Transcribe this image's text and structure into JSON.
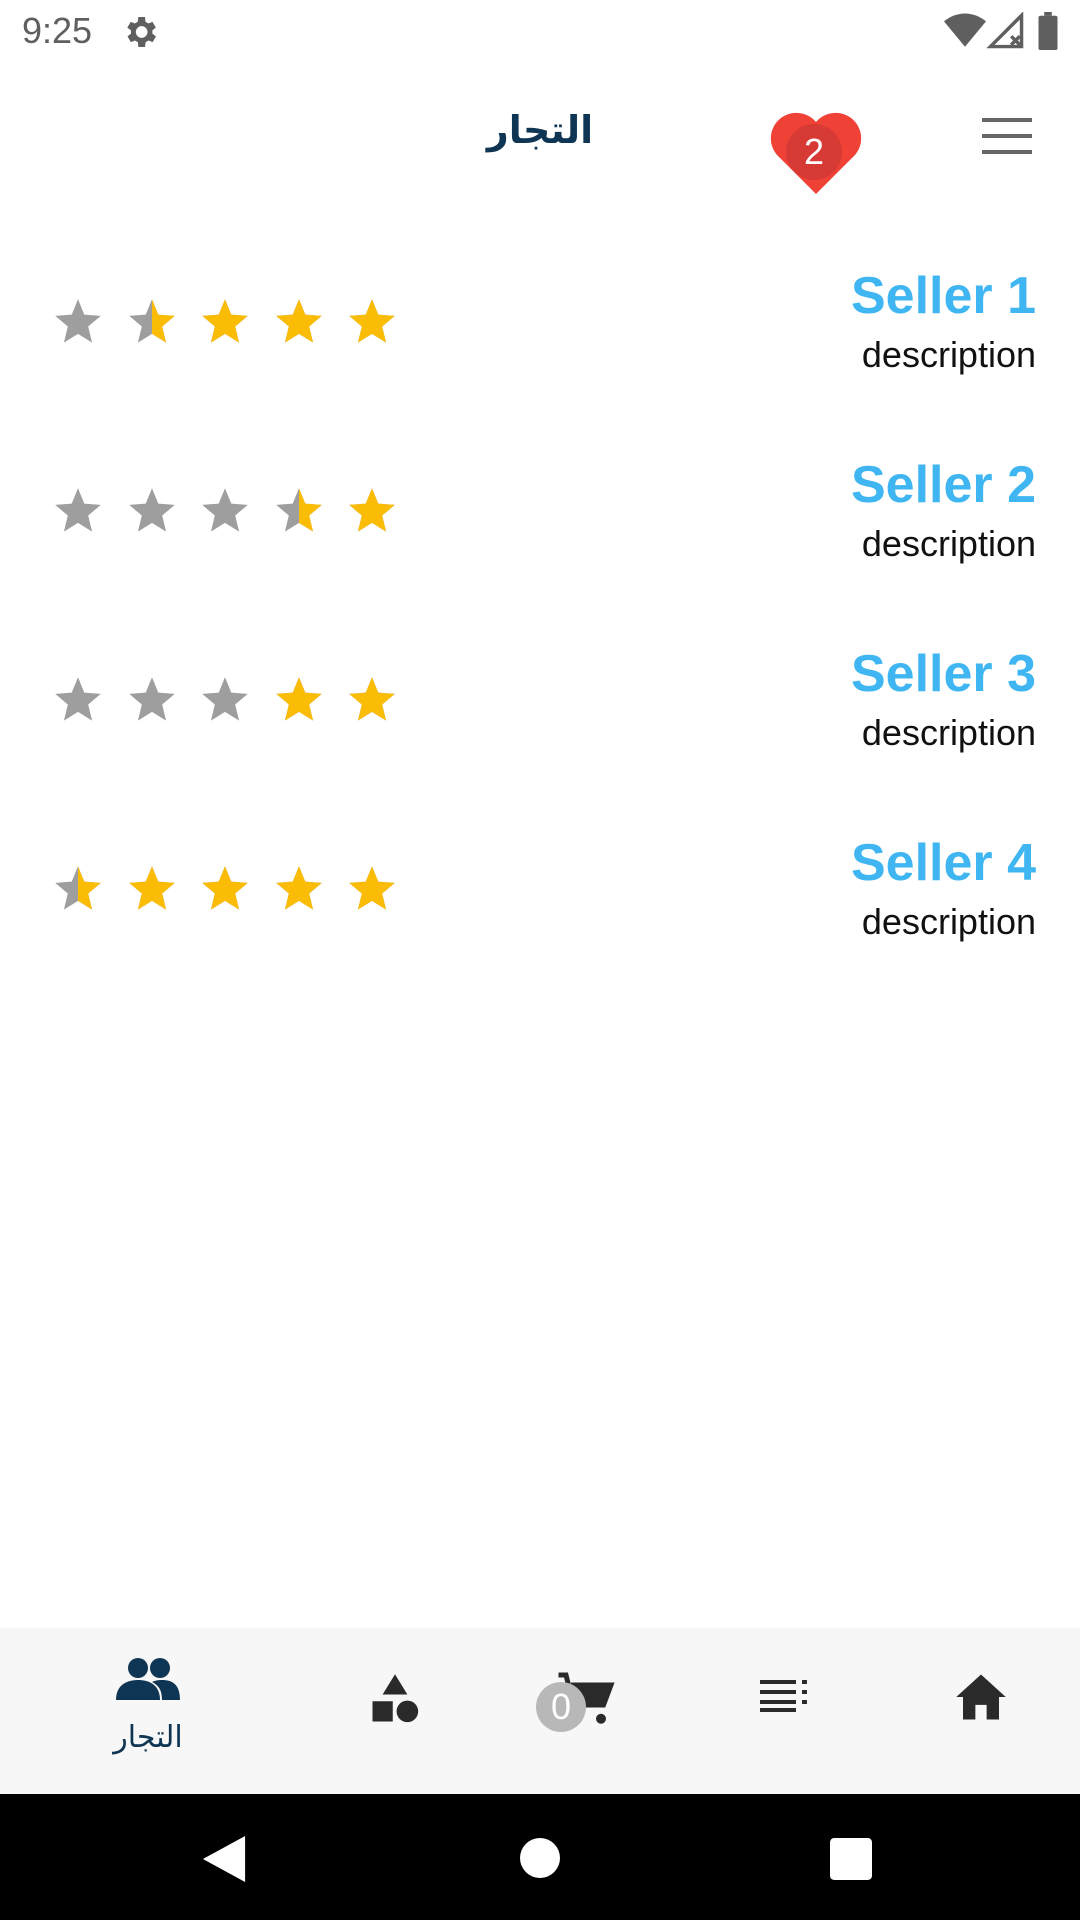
{
  "status_bar": {
    "time": "9:25"
  },
  "app_bar": {
    "title": "التجار",
    "favorites_count": "2"
  },
  "sellers": [
    {
      "name": "Seller 1",
      "description": "description",
      "rating": 3.5
    },
    {
      "name": "Seller 2",
      "description": "description",
      "rating": 1.5
    },
    {
      "name": "Seller 3",
      "description": "description",
      "rating": 2
    },
    {
      "name": "Seller 4",
      "description": "description",
      "rating": 4.5
    }
  ],
  "bottom_nav": {
    "items": [
      {
        "icon": "people-icon",
        "label": "التجار",
        "active": true
      },
      {
        "icon": "categories-icon",
        "label": ""
      },
      {
        "icon": "cart-icon",
        "label": "",
        "badge": "0"
      },
      {
        "icon": "list-icon",
        "label": ""
      },
      {
        "icon": "home-icon",
        "label": ""
      }
    ]
  },
  "colors": {
    "accent": "#3fb6f2",
    "title": "#0e3553",
    "star_filled": "#fbbc05",
    "star_empty": "#9e9e9e",
    "heart": "#ef4136"
  }
}
